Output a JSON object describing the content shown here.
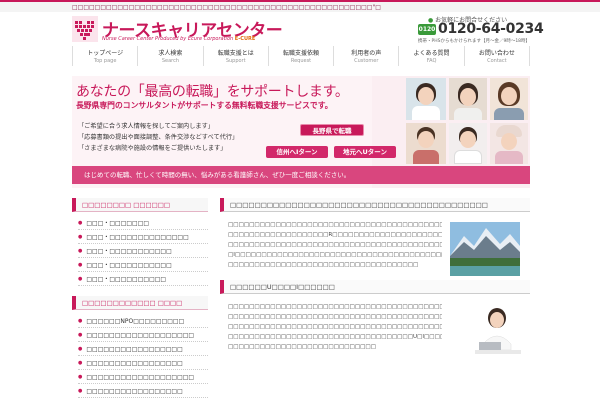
{
  "topbar": {
    "text": "□□□□□□□□□□□□□□□□□□□□□□□□□□□□□□□□□□□□□□□□□□□□□□□□□□□□□\"□"
  },
  "logo": {
    "title": "ナースキャリアセンター",
    "sub_prefix": "Nurse Career Center Produced by Ecure Corporation",
    "sub_brand": "E-CURE"
  },
  "contact": {
    "note": "お気軽にお問合せください",
    "badge": "0120",
    "tel": "0120-64-0234",
    "hours": "携帯・PHSからもかけられます【月～金／9時～18時】"
  },
  "nav": [
    {
      "jp": "トップページ",
      "en": "Top page"
    },
    {
      "jp": "求人検索",
      "en": "Search"
    },
    {
      "jp": "転職支援とは",
      "en": "Support"
    },
    {
      "jp": "転職支援依頼",
      "en": "Request"
    },
    {
      "jp": "利用者の声",
      "en": "Customer"
    },
    {
      "jp": "よくある質問",
      "en": "FAQ"
    },
    {
      "jp": "お問い合わせ",
      "en": "Contact"
    }
  ],
  "hero": {
    "headline": "あなたの「最高の転職」をサポートします。",
    "sub": "長野県専門のコンサルタントがサポートする無料転職支援サービスです。",
    "list": [
      "「ご希望に合う求人情報を探してご案内します」",
      "「応募書類の提出や面接調整、条件交渉などすべて代行」",
      "「さまざまな病院や施設の情報をご提供いたします」"
    ],
    "badge_nagano": "長野県で転職",
    "badge_shinshu": "信州へIターン",
    "badge_jimoto": "地元へUターン",
    "bottom": "はじめての転職、忙しくて時間の無い、悩みがある看護師さん、ぜひ一度ご相談ください。"
  },
  "sidebar": {
    "section1": {
      "title": "□□□□□□□□ □□□□□□",
      "items": [
        "□□□・□□□□□□□",
        "□□□・□□□□□□□□□□□□□□",
        "□□□・□□□□□□□□□□□",
        "□□□・□□□□□□□□□□□",
        "□□□・□□□□□□□□□□"
      ]
    },
    "section2": {
      "title": "□□□□□□□□□□□□ □□□□",
      "items": [
        "□□□□□□NPO□□□□□□□□□",
        "□□□□□□□□□□□□□□□□□□□",
        "□□□□□□□□□□□□□□□□□",
        "□□□□□□□□□□□□□□□□□",
        "□□□□□□□□□□□□□□□□□□□",
        "□□□□□□□□□□□□□□□□□"
      ]
    }
  },
  "main": {
    "section1": {
      "title": "□□□□□□□□□□□□□□□□□□□□□□□□□□□□□□□□□□□□□□□□□□",
      "lines": [
        "□□□□□□□□□□□□□□□□□□□□□□□□□□□□□□□□□□□□□□□□□□□□□□□□□□",
        "□□□□□□□□□□□□□□□□□□□R□□□□□□□□□□□□□□□□□□□□□□□□□□□□□□",
        "□□□□□□□□□□□□□□□□□□□□□□□□□□□□□□□□□□□□□□□□□□U□□□□□□□□",
        "□I□□□□□□□□□□□□□□□□□□□□□□□□□□□□□□□□□□□□□□□□□□□□□□□□",
        "□□□□□□□□□□□□□□□□□□□□□□□□□□□□□□□□□□□□"
      ]
    },
    "section2": {
      "title": "□□□□□□U□□□□I□□□□□□",
      "lines": [
        "□□□□□□□□□□□□□□□□□□□□□□□□□□□□□□□□□□□□□□□□□□□□□□□□",
        "□□□□□□□□□□□□□□□□□□□□□□□□□□□□□□□□□□□□□□□□□□□□□□□□",
        "□□□□□□□□□□□□□□□□□□□□□□□□□□□□□□□□□□□□□□□□□□□□□□□□",
        "□□□□□□□□□□□□□□□□□□□□□□□□□□□□□□□□□□□U□I□□□□□□□□□□",
        "□□□□□□□□□□□□□□□□□□□□□□□□□□□□"
      ]
    }
  },
  "colors": {
    "accent": "#c8195a",
    "accent_light": "#d9467e",
    "hero_bg": "#fbeef2",
    "tel_green": "#3a9a3a"
  }
}
